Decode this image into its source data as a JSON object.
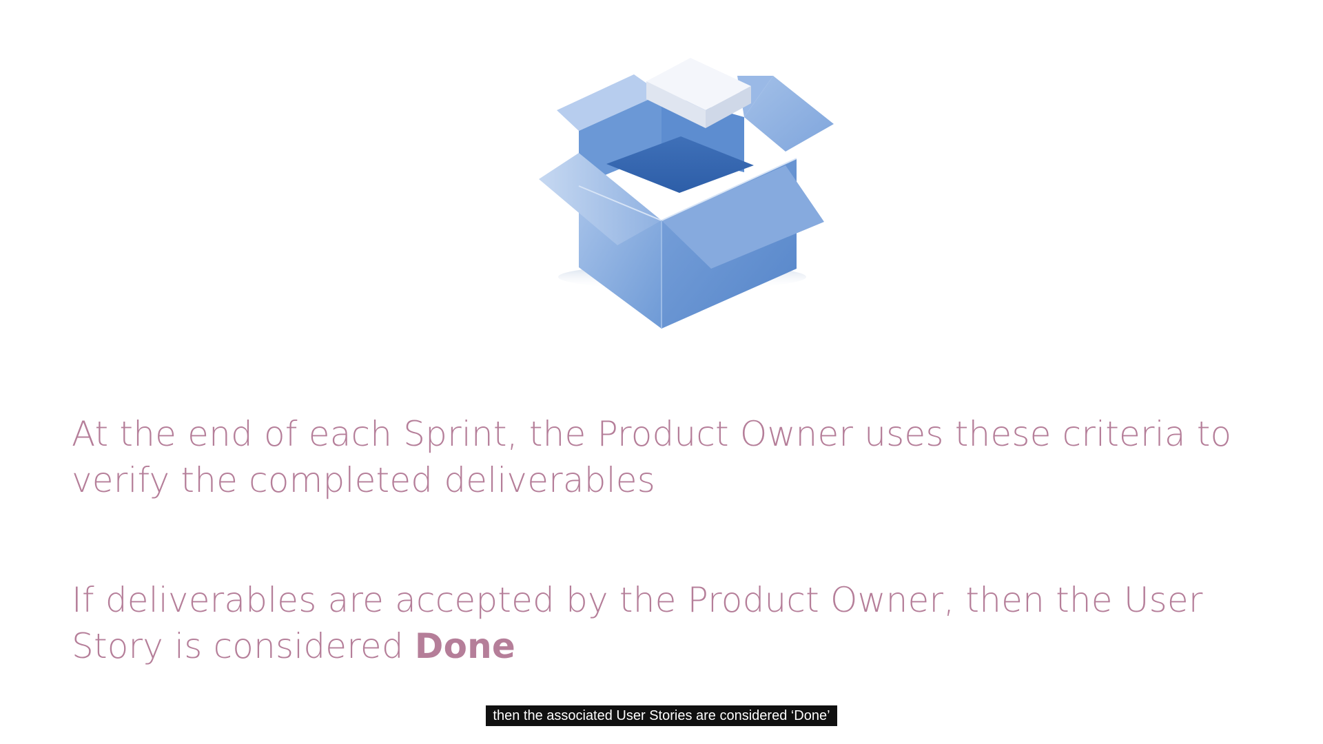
{
  "slide": {
    "illustration_icon": "open-box-icon",
    "bullet_1": "At the end of each Sprint, the Product Owner uses these criteria to verify the completed deliverables",
    "bullet_2_prefix": "If deliverables are accepted by the Product Owner, then the User Story is considered ",
    "bullet_2_emphasis": "Done"
  },
  "caption": {
    "text": "then the associated User Stories are considered ‘Done’"
  },
  "colors": {
    "text": "#b57e99",
    "box_blue": "#4f83c8",
    "caption_bg": "#101010"
  }
}
